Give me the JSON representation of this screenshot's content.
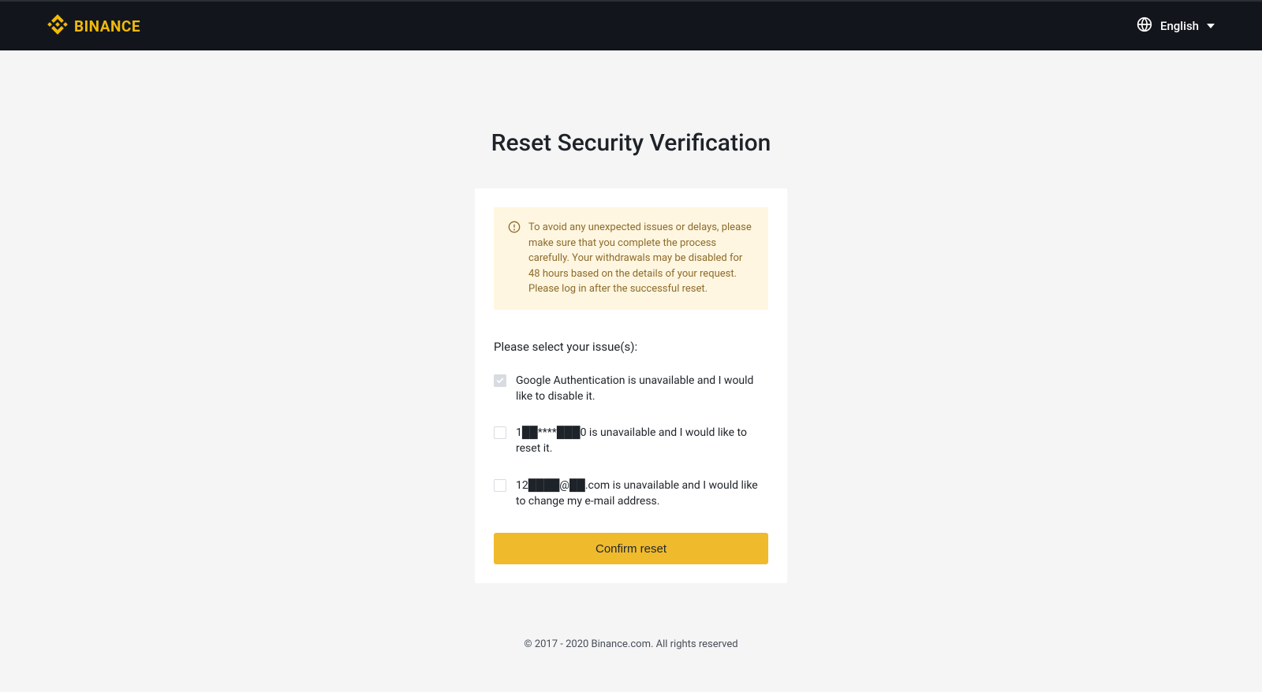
{
  "header": {
    "brand": "BINANCE",
    "language": "English"
  },
  "page": {
    "title": "Reset Security Verification"
  },
  "warning": {
    "line1": "To avoid any unexpected issues or delays, please make sure that you complete the process carefully. Your withdrawals may be disabled for 48 hours based on the details of your request.",
    "line2": "Please log in after the successful reset."
  },
  "form": {
    "prompt": "Please select your issue(s):",
    "options": [
      {
        "label": "Google Authentication is unavailable and I would like to disable it.",
        "checked": true
      },
      {
        "label": "1██****███0 is unavailable and I would like to reset it.",
        "checked": false
      },
      {
        "label": "12████@██.com is unavailable and I would like to change my e-mail address.",
        "checked": false
      }
    ],
    "confirm_label": "Confirm reset"
  },
  "footer": {
    "copyright": "© 2017 - 2020 Binance.com. All rights reserved"
  }
}
